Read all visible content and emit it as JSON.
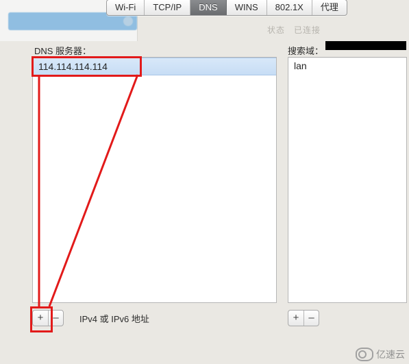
{
  "tabs": {
    "wifi": "Wi-Fi",
    "tcpip": "TCP/IP",
    "dns": "DNS",
    "wins": "WINS",
    "8021x": "802.1X",
    "proxy": "代理"
  },
  "labels": {
    "dns_servers": "DNS 服务器：",
    "search_domains": "搜索域：",
    "hint": "IPv4 或 IPv6 地址"
  },
  "dns_servers": {
    "0": "114.114.114.114"
  },
  "search_domains": {
    "0": "lan"
  },
  "buttons": {
    "plus": "+",
    "minus": "–"
  },
  "status_faint": "状态　已连接",
  "watermark": "亿速云"
}
